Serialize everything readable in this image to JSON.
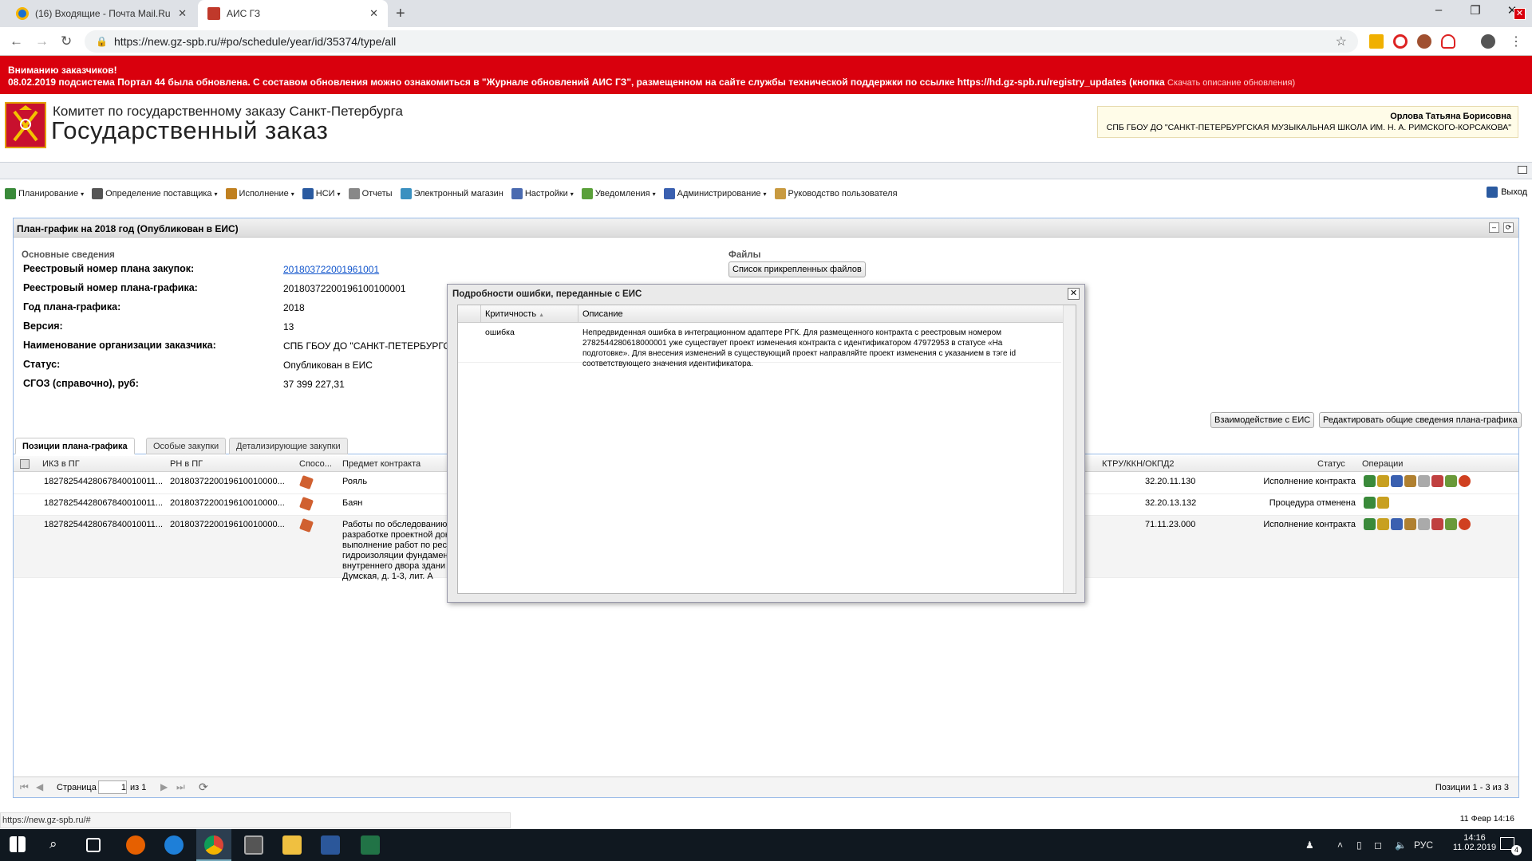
{
  "browser": {
    "tabs": [
      {
        "title": "(16) Входящие - Почта Mail.Ru",
        "icon": "mail-ru-icon",
        "active": false
      },
      {
        "title": "АИС ГЗ",
        "icon": "gavel-icon",
        "active": true
      }
    ],
    "url": "https://new.gz-spb.ru/#po/schedule/year/id/35374/type/all"
  },
  "alert": {
    "line1": "Вниманию заказчиков!",
    "line2": "08.02.2019 подсистема Портал 44 была обновлена. С составом обновления можно ознакомиться в \"Журнале обновлений АИС ГЗ\", размещенном на сайте службы технической поддержки по ссылке https://hd.gz-spb.ru/registry_updates (кнопка",
    "link": "Скачать описание обновления)",
    "close": "✕"
  },
  "header": {
    "org_small": "Комитет по государственному заказу Санкт-Петербурга",
    "org_big": "Государственный заказ",
    "user_name": "Орлова Татьяна Борисовна",
    "user_org": "СПБ ГБОУ ДО \"САНКТ-ПЕТЕРБУРГСКАЯ МУЗЫКАЛЬНАЯ ШКОЛА ИМ. Н. А. РИМСКОГО-КОРСАКОВА\""
  },
  "menu": {
    "items": [
      {
        "label": "Планирование",
        "dropdown": true,
        "color": "#3a8a3a"
      },
      {
        "label": "Определение поставщика",
        "dropdown": true,
        "color": "#555555"
      },
      {
        "label": "Исполнение",
        "dropdown": true,
        "color": "#c08020"
      },
      {
        "label": "НСИ",
        "dropdown": true,
        "color": "#2a5aa0"
      },
      {
        "label": "Отчеты",
        "dropdown": false,
        "color": "#888888"
      },
      {
        "label": "Электронный магазин",
        "dropdown": false,
        "color": "#3a90c0"
      },
      {
        "label": "Настройки",
        "dropdown": true,
        "color": "#4a6ab0"
      },
      {
        "label": "Уведомления",
        "dropdown": true,
        "color": "#5aa03a"
      },
      {
        "label": "Администрирование",
        "dropdown": true,
        "color": "#3a60b0"
      },
      {
        "label": "Руководство пользователя",
        "dropdown": false,
        "color": "#c89a40"
      }
    ],
    "logout": "Выход"
  },
  "panel": {
    "title": "План-график на 2018 год (Опубликован в ЕИС)",
    "section_title": "Основные сведения",
    "fields": [
      {
        "label": "Реестровый номер плана закупок:",
        "value": "201803722001961001",
        "link": true
      },
      {
        "label": "Реестровый номер плана-графика:",
        "value": "20180372200196100100001"
      },
      {
        "label": "Год плана-графика:",
        "value": "2018"
      },
      {
        "label": "Версия:",
        "value": "13"
      },
      {
        "label": "Наименование организации заказчика:",
        "value": "СПБ ГБОУ ДО \"САНКТ-ПЕТЕРБУРГСКАЯ"
      },
      {
        "label": "Статус:",
        "value": "Опубликован в ЕИС"
      },
      {
        "label": "СГОЗ (справочно), руб:",
        "value": "37 399 227,31"
      }
    ],
    "files_title": "Файлы",
    "files_button": "Список прикрепленных файлов",
    "btn_eis": "Взаимодействие с ЕИС",
    "btn_edit": "Редактировать общие сведения плана-графика",
    "tabs": [
      "Позиции плана-графика",
      "Особые закупки",
      "Детализирующие закупки"
    ],
    "grid": {
      "headers": {
        "ikz": "ИКЗ в ПГ",
        "rn": "РН в ПГ",
        "method": "Спосо...",
        "subject": "Предмет контракта",
        "ktru": "КТРУ/ККН/ОКПД2",
        "status": "Статус",
        "ops": "Операции"
      },
      "rows": [
        {
          "ikz": "18278254428067840010011...",
          "rn": "2018037220019610010000...",
          "subject": [
            "Рояль"
          ],
          "ktru": "32.20.11.130",
          "status": "Исполнение контракта",
          "ops": 8
        },
        {
          "ikz": "18278254428067840010011...",
          "rn": "2018037220019610010000...",
          "subject": [
            "Баян"
          ],
          "ktru": "32.20.13.132",
          "status": "Процедура отменена",
          "ops": 2
        },
        {
          "ikz": "18278254428067840010011...",
          "rn": "2018037220019610010000...",
          "subject": [
            "Работы по обследованию",
            "разработке проектной док",
            "выполнение работ по рес",
            "гидроизоляции фундамен",
            "внутреннего двора здани",
            "Думская, д. 1-3, лит. А"
          ],
          "ktru": "71.11.23.000",
          "status": "Исполнение контракта",
          "ops": 8
        }
      ]
    },
    "pager": {
      "page_label": "Страница",
      "page": "1",
      "of": "из 1",
      "summary": "Позиции 1 - 3 из 3"
    }
  },
  "modal": {
    "title": "Подробности ошибки, переданные с ЕИС",
    "col_severity": "Критичность",
    "col_desc": "Описание",
    "row": {
      "severity": "ошибка",
      "lines": [
        "Непредвиденная ошибка в интеграционном адаптере РГК. Для размещенного контракта с реестровым номером",
        "2782544280618000001 уже существует проект изменения контракта с идентификатором 47972953 в статусе «На",
        "подготовке». Для внесения изменений в существующий проект направляйте проект изменения с указанием в тэге id",
        "соответствующего значения идентификатора."
      ]
    }
  },
  "statusbar": {
    "url": "https://new.gz-spb.ru/#",
    "date": "11 Февр 14:16"
  },
  "taskbar": {
    "lang": "РУС",
    "time": "14:16",
    "date": "11.02.2019",
    "notif": "4"
  }
}
